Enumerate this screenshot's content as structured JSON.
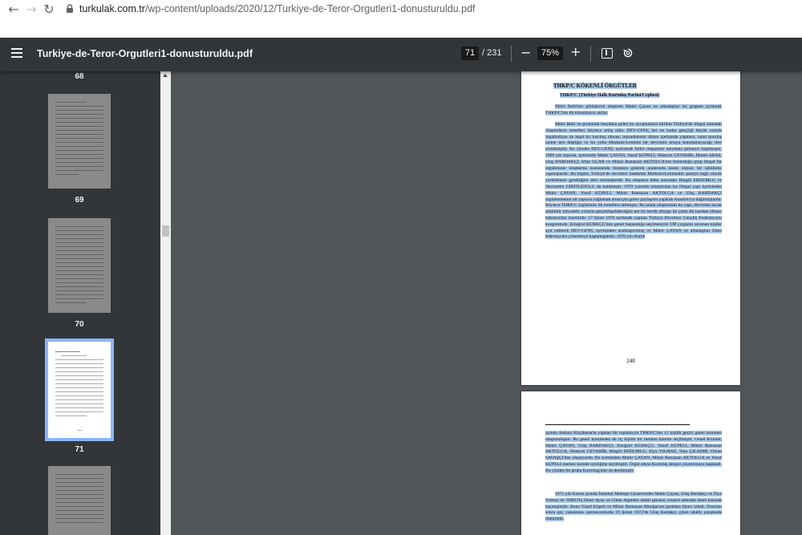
{
  "browser": {
    "back_icon": "back-arrow-icon",
    "forward_icon": "forward-arrow-icon",
    "reload_icon": "reload-icon",
    "url_host": "turkulak.com.tr",
    "url_path": "/wp-content/uploads/2020/12/Turkiye-de-Teror-Orgutleri1-donusturuldu.pdf"
  },
  "toolbar": {
    "title": "Turkiye-de-Teror-Orgutleri1-donusturuldu.pdf",
    "current_page": "71",
    "total_pages": "/ 231",
    "zoom": "75%",
    "zoom_out_label": "−",
    "zoom_in_label": "+"
  },
  "sidebar": {
    "thumbnails": [
      {
        "label": "68"
      },
      {
        "label": "69"
      },
      {
        "label": "70"
      },
      {
        "label": "71",
        "active": true
      }
    ]
  },
  "page1": {
    "heading1": "THKP/C KÖKENLİ ÖRGÜTLER",
    "heading2": "THKP/C (Türkiye Halk Kurtuluş Partisi/Cephesi)",
    "para1": "Mihri Belli'nin görüşlerini eleştiren Mahir Çayan ve arkadaşları bu gruptan ayrılarak THKP/C'nin ilk tohumlarını attılar.",
    "para2": "Mihri Belli ve grubunda meydana gelen bu ayrışmalarla birlikte Türkiye'de illegal alandaki oluşumların temelleri böylece atılış oldu. DEV-GENÇ her ne kadar gençliği büyük oranda örgütlediyse de legal bir kuruluş olması, mücadelesini düzen içerisinde yapması, onun kuruluş özüne ters düştüğü ve bu yolla Marksist-Leninist bir devrimin ortaya konulamayacağı ileri sürülmüştür. Bu yüzden DEV-GENÇ içerisinde farklı oluşumlar meydana gelmeye başlamıştır. 1969 yılı kışında, içerisinde Mahir ÇAYAN, Yusuf KÜPELİ, Hüseyin CEVAHİR, İlhami ARAS, Ulaş BARDAKÇI, İrfan UÇAR ve Münir Ramazan AKTOLGA'nın bulunduğu grup illegal bir örgütlenme oluşturma konusunda biraraya gelerek aralarında kesin olayan bir işbölümü yapmışlardır. Bu kişiler, Türkiye'de devrimci hareketin Marksist-Leninistbir partiye bağlı olarak yürütülmesi gerektiğini ileri sürmüşlerdir. Bu oluşuma daha sonradan Bingöl ERDUMLU ve Necmettin GİRİTLİOĞLU da katılmıştır. 1970 yazında oluşturulan bu illegal yapı içerisinden Mahir ÇAYAN, Yusuf KÜPELİ, Münir Ramazan AKTOLGA ve Ulaş BARDAKÇI örgütlenmenin alt yapısını sağlamak amacıyla görev paylaşımı yaparak Anadolu'ya dağılmışlardır. Böylece THKP/C örgütünün ilk temelleri atılmıştır. Bu arada oluşturulan bu yapı, devrimin ancak silahlıbir mücadele yoluyla gerçekleşebileceğini net bir teorik altyapı ile çizen ilk hareket olması bakımından önemlidir. 17 Ekim 1970 tarihinde yapılan Türkiye Devrimci Gençlik Federasyonu kongresinde, Ertuğrul KÜRKÇÜ'nün genel başkanlığa seçilmesiyle TİP çizgisini savunan kişiler ayıt edilerek DEV-GENÇ içerisinden uzaklaştırılmış ve Mahir ÇAYAN ve arkadaşları fiilen federasyonu yönetmeye başlamışlardır. 1970 yılı Aralık",
    "page_number": "248"
  },
  "page2": {
    "para1": "ayında Ankara Küçükesat'ta yapılan bir toplantıyla THKP/C'nin 11 kişilik geçici genel komitesi oluşturuluştur. Bu genel komiteden de üç kişilik bir merkez komite seçilmiştir. Genel Komite; Mahir ÇAYAN, Ulaş BARDAKÇI, Ertuğrul KÜRKÇÜ, Yusuf KÜPELİ, Münir Ramazan AKTOLGA, Hüseyin CEVAHİR, Bingöl ERDUMLU, Ziya YILMAZ, Sina ÇILADIR, Orhan SAVAŞÇI'dan oluşuyordu. Bu komiteden Mahir ÇAYAN, Münir Ramazan AKTOLGA ve Yusuf KÜPELİ merkez komite üyeliğine seçilmiştir. Örgüt adına Kurtuluş dergisi çıkartılmaya başlandı. Bu yüzden bu gruba Kurtuluşçular da denilmiştir.",
    "para2": "1971 yılı Kasım ayında İstanbul Maltepe Cezaevinden Mahir Çayan, Ulaş Bardakçı ve Ziya Yılmaz ile THKO'lu Ömer Ayna ve Cihan Alptekin isimli şahıslar cezaevi altından tünel kazarak kaçmışlardır. Bunu Yusuf Küpeli ve Münir Ramazan Aktolga'nın partiden ihracı izledi. Firardan sonra geç yakalanan operasyonlarda 19 Şubat 1972'de Ulaş Bardakçı çıkan silahlı çatışmada öldürüldü."
  }
}
